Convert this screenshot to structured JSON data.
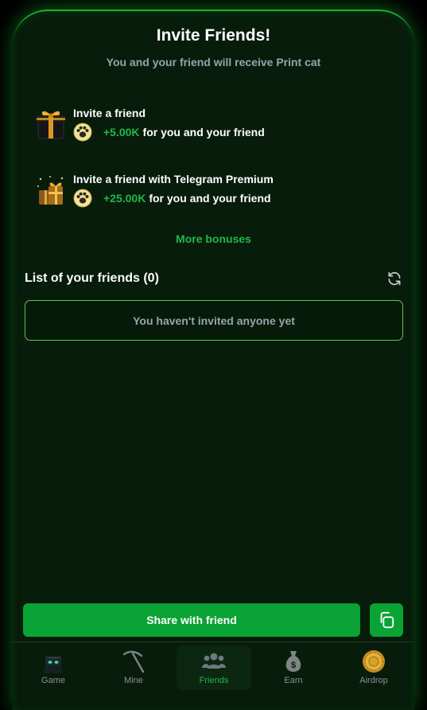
{
  "header": {
    "title": "Invite Friends!",
    "subtitle": "You and your friend will receive Print cat"
  },
  "rewards": [
    {
      "icon": "gift-box-icon",
      "title": "Invite a friend",
      "amount": "+5.00K",
      "description": "for you and your friend"
    },
    {
      "icon": "premium-gifts-icon",
      "title": "Invite a friend with Telegram Premium",
      "amount": "+25.00K",
      "description": "for you and your friend"
    }
  ],
  "more_bonuses_label": "More bonuses",
  "friends": {
    "header": "List of your friends (0)",
    "empty_message": "You haven't invited anyone yet"
  },
  "actions": {
    "share_label": "Share with friend"
  },
  "nav": [
    {
      "label": "Game",
      "icon": "cat-icon",
      "active": false
    },
    {
      "label": "Mine",
      "icon": "pickaxe-icon",
      "active": false
    },
    {
      "label": "Friends",
      "icon": "friends-icon",
      "active": true
    },
    {
      "label": "Earn",
      "icon": "money-bag-icon",
      "active": false
    },
    {
      "label": "Airdrop",
      "icon": "coin-icon",
      "active": false
    }
  ],
  "colors": {
    "background": "#071c0b",
    "accent": "#0aa335",
    "accent_text": "#1fb84a",
    "muted_text": "#9aa3ad",
    "border_glow": "#1bb534"
  }
}
